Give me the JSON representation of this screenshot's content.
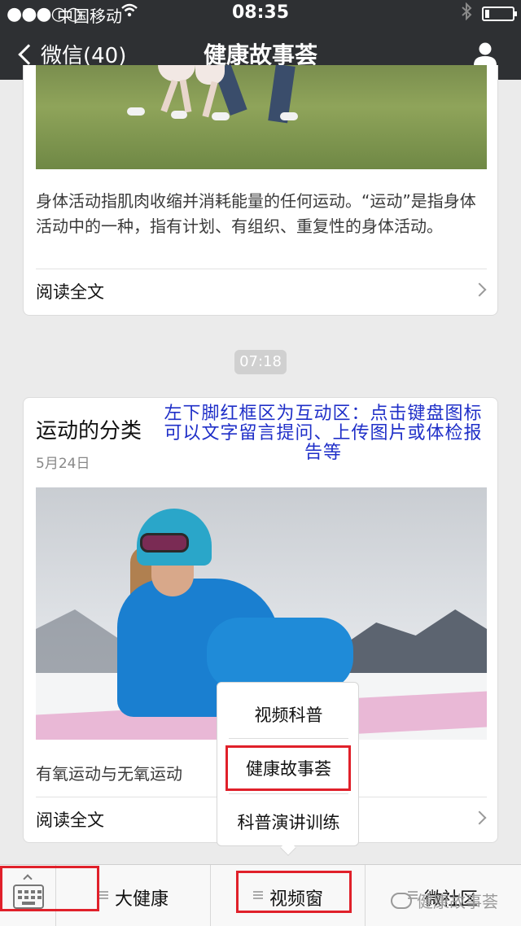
{
  "status_bar": {
    "signal": "●●●○○",
    "carrier": "中国移动",
    "wifi_icon": "wifi-icon",
    "time": "08:35",
    "bluetooth_icon": "bluetooth-icon",
    "battery_level": 0.15
  },
  "nav": {
    "back_label": "微信(40)",
    "title": "健康故事荟",
    "profile_icon": "person-icon"
  },
  "article1": {
    "description": "身体活动指肌肉收缩并消耗能量的任何运动。“运动”是指身体活动中的一种，指有计划、有组织、重复性的身体活动。",
    "read_all": "阅读全文"
  },
  "timestamp": "07:18",
  "article2": {
    "title": "运动的分类",
    "date": "5月24日",
    "annotation": "左下脚红框区为互动区：点击键盘图标可以文字留言提问、上传图片或体检报告等",
    "subtitle": "有氧运动与无氧运动",
    "read_all": "阅读全文"
  },
  "popup_menu": {
    "items": [
      "视频科普",
      "健康故事荟",
      "科普演讲训练"
    ]
  },
  "bottom_menu": {
    "keyboard_icon": "keyboard-icon",
    "items": [
      "大健康",
      "视频窗",
      "微社区"
    ]
  },
  "watermark": "健康故事荟",
  "colors": {
    "nav_bg": "#2e3033",
    "highlight_box": "#e0202a",
    "annotation_text": "#1f2fc8"
  }
}
